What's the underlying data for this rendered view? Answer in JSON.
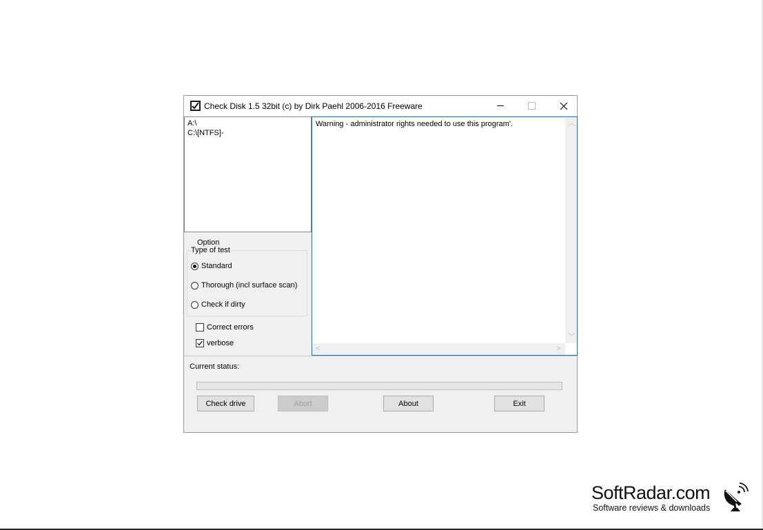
{
  "window": {
    "title": "Check Disk 1.5 32bit (c) by Dirk Paehl  2006-2016 Freeware",
    "icon": "check-disk-app-icon",
    "controls": {
      "minimize_icon": "minimize-icon",
      "maximize_icon": "maximize-icon",
      "close_icon": "close-icon"
    }
  },
  "drives": [
    "A:\\",
    "C:\\[NTFS]-"
  ],
  "log": {
    "lines": [
      "Warning - administrator rights needed to use this program'."
    ]
  },
  "options": {
    "group_label": "Option",
    "type_label": "Type of test",
    "tests": [
      {
        "label": "Standard",
        "selected": true
      },
      {
        "label": "Thorough (incl surface scan)",
        "selected": false
      },
      {
        "label": "Check if dirty",
        "selected": false
      }
    ],
    "checks": [
      {
        "label": "Correct errors",
        "checked": false
      },
      {
        "label": "verbose",
        "checked": true
      }
    ]
  },
  "status": {
    "label": "Current status:",
    "progress": 0
  },
  "buttons": {
    "check_drive": "Check drive",
    "abort": "Abort",
    "about": "About",
    "exit": "Exit"
  },
  "watermark": {
    "name": "SoftRadar.com",
    "tagline": "Software reviews & downloads",
    "logo_icon": "satellite-dish-icon"
  },
  "colors": {
    "accent": "#0078d7",
    "window_bg": "#f0f0f0",
    "disabled_button_bg": "#cccccc"
  }
}
